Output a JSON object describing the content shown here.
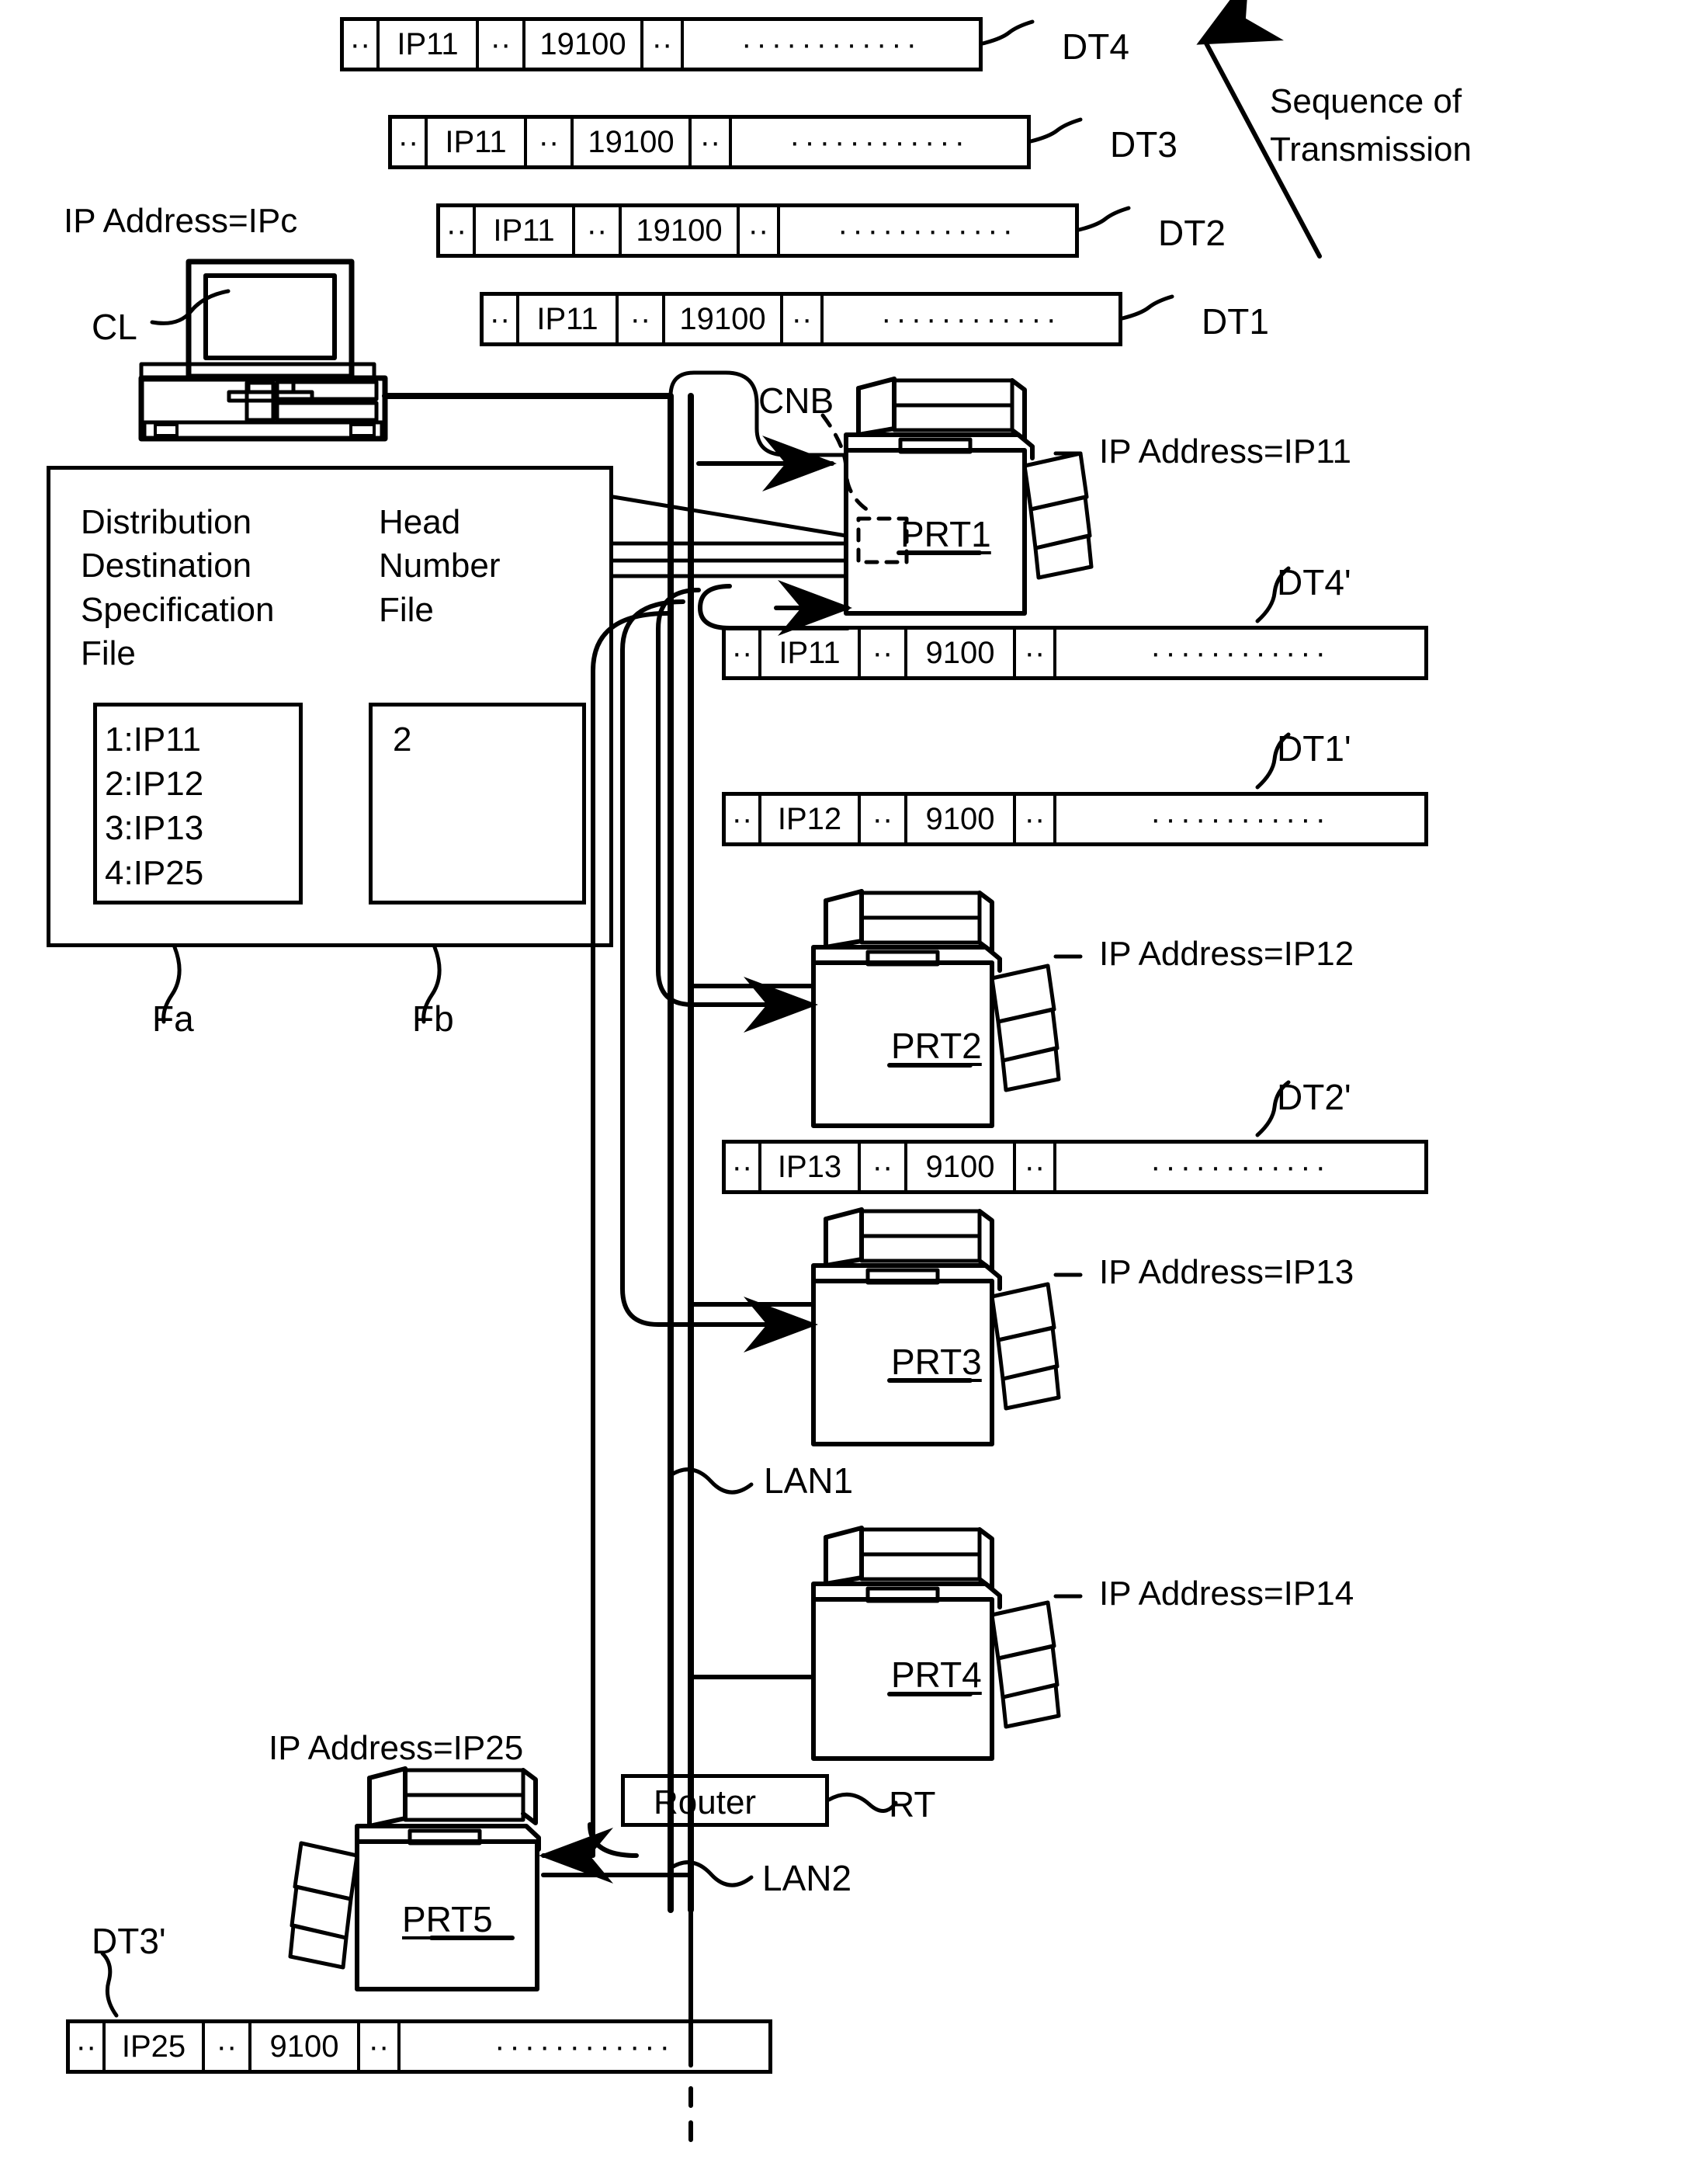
{
  "figure": {
    "sequence_label_line1": "Sequence of",
    "sequence_label_line2": "Transmission"
  },
  "client": {
    "ip_label": "IP Address=IPc",
    "name": "CL"
  },
  "files_panel": {
    "file_a": {
      "title_lines": [
        "Distribution",
        "Destination",
        "Specification",
        "File"
      ],
      "entries": [
        "1:IP11",
        "2:IP12",
        "3:IP13",
        "4:IP25"
      ],
      "ref": "Fa"
    },
    "file_b": {
      "title_lines": [
        "Head",
        "Number",
        "File"
      ],
      "entries": [
        "2"
      ],
      "ref": "Fb"
    }
  },
  "outgoing_packets": [
    {
      "ref": "DT4",
      "dots1": "··",
      "ip": "IP11",
      "dots2": "··",
      "port": "19100",
      "dots3": "··",
      "payload": "············"
    },
    {
      "ref": "DT3",
      "dots1": "··",
      "ip": "IP11",
      "dots2": "··",
      "port": "19100",
      "dots3": "··",
      "payload": "············"
    },
    {
      "ref": "DT2",
      "dots1": "··",
      "ip": "IP11",
      "dots2": "··",
      "port": "19100",
      "dots3": "··",
      "payload": "············"
    },
    {
      "ref": "DT1",
      "dots1": "··",
      "ip": "IP11",
      "dots2": "··",
      "port": "19100",
      "dots3": "··",
      "payload": "············"
    }
  ],
  "forwarded_packets": [
    {
      "ref": "DT4'",
      "dots1": "··",
      "ip": "IP11",
      "dots2": "··",
      "port": "9100",
      "dots3": "··",
      "payload": "············"
    },
    {
      "ref": "DT1'",
      "dots1": "··",
      "ip": "IP12",
      "dots2": "··",
      "port": "9100",
      "dots3": "··",
      "payload": "············"
    },
    {
      "ref": "DT2'",
      "dots1": "··",
      "ip": "IP13",
      "dots2": "··",
      "port": "9100",
      "dots3": "··",
      "payload": "············"
    },
    {
      "ref": "DT3'",
      "dots1": "··",
      "ip": "IP25",
      "dots2": "··",
      "port": "9100",
      "dots3": "··",
      "payload": "············"
    }
  ],
  "printers": [
    {
      "name": "PRT1",
      "ip_label": "IP Address=IP11"
    },
    {
      "name": "PRT2",
      "ip_label": "IP Address=IP12"
    },
    {
      "name": "PRT3",
      "ip_label": "IP Address=IP13"
    },
    {
      "name": "PRT4",
      "ip_label": "IP Address=IP14"
    },
    {
      "name": "PRT5",
      "ip_label": "IP Address=IP25"
    }
  ],
  "network": {
    "cnb_label": "CNB",
    "lan1_label": "LAN1",
    "lan2_label": "LAN2",
    "router_label": "Router",
    "router_ref": "RT"
  }
}
